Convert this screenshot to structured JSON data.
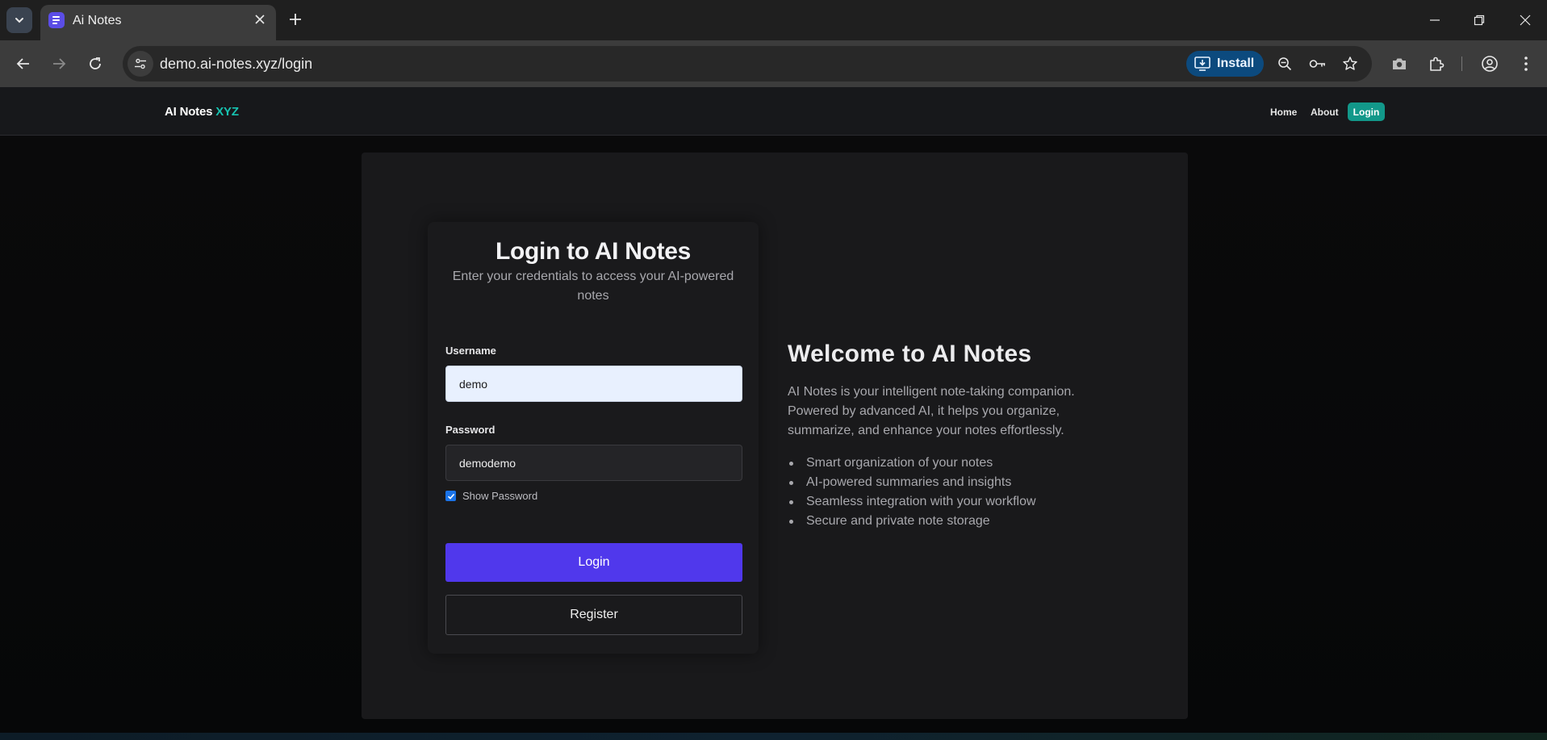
{
  "browser": {
    "tab_title": "Ai Notes",
    "url": "demo.ai-notes.xyz/login",
    "install_label": "Install"
  },
  "header": {
    "brand": "AI Notes",
    "brand_accent": "XYZ",
    "nav": {
      "home": "Home",
      "about": "About",
      "login": "Login"
    }
  },
  "login": {
    "title": "Login to AI Notes",
    "subtitle": "Enter your credentials to access your AI-powered notes",
    "username_label": "Username",
    "username_value": "demo",
    "password_label": "Password",
    "password_value": "demodemo",
    "show_password_label": "Show Password",
    "show_password_checked": true,
    "login_button": "Login",
    "register_button": "Register"
  },
  "welcome": {
    "title": "Welcome to AI Notes",
    "description": "AI Notes is your intelligent note-taking companion. Powered by advanced AI, it helps you organize, summarize, and enhance your notes effortlessly.",
    "features": [
      "Smart organization of your notes",
      "AI-powered summaries and insights",
      "Seamless integration with your workflow",
      "Secure and private note storage"
    ]
  },
  "colors": {
    "accent_teal": "#12988a",
    "primary_button": "#5038ec",
    "install_button": "#0c4a7e"
  }
}
